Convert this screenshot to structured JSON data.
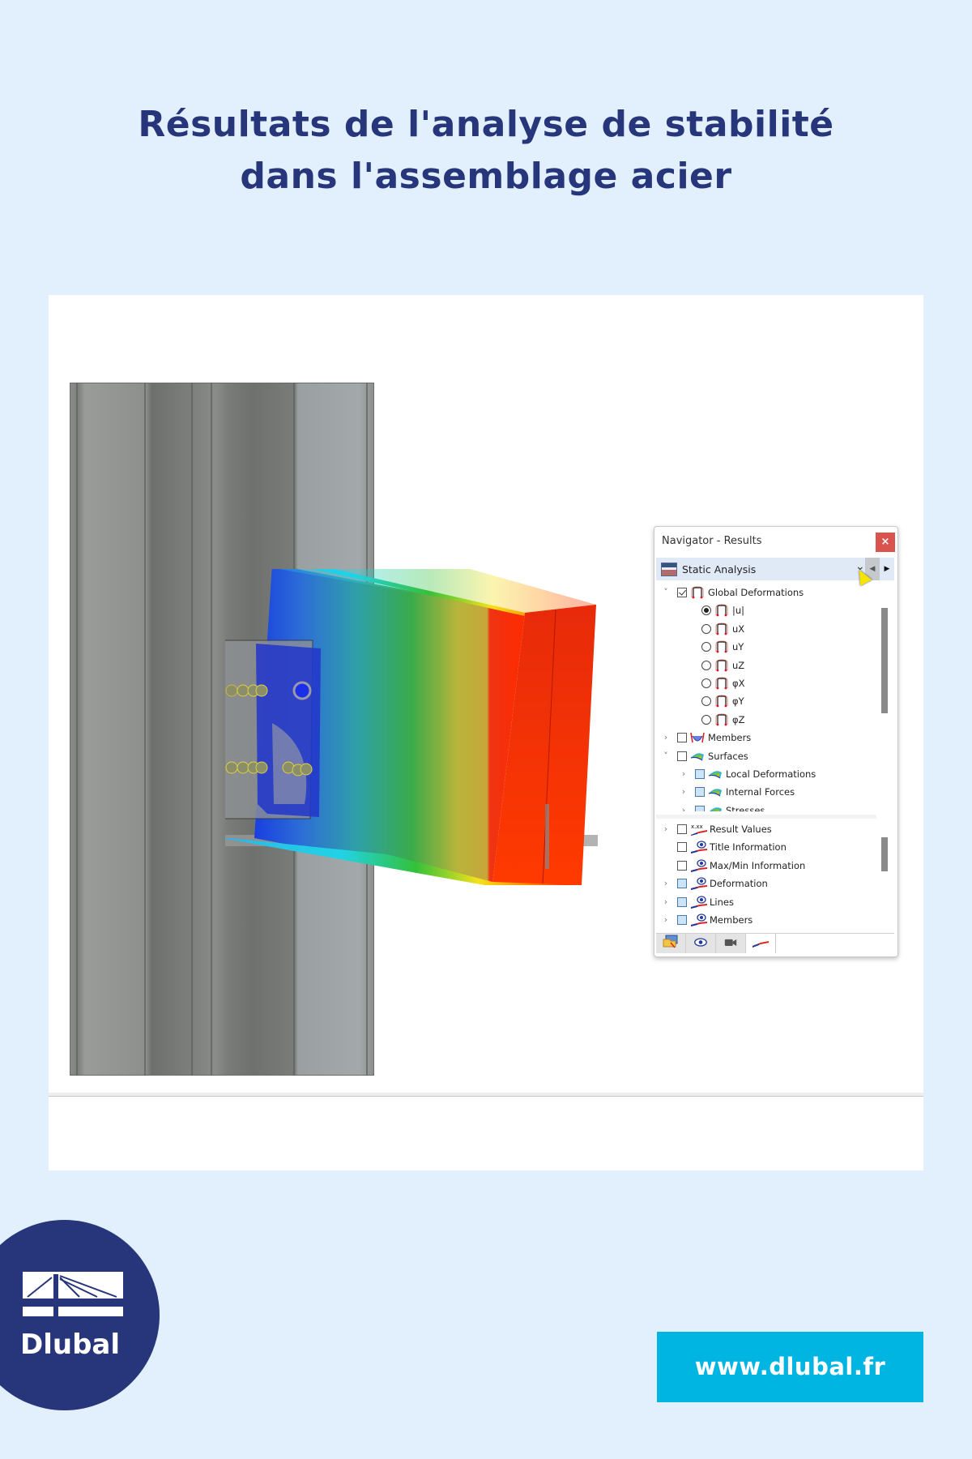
{
  "title": {
    "line1": "Résultats de l'analyse de stabilité",
    "line2": "dans l'assemblage acier"
  },
  "navigator": {
    "title": "Navigator - Results",
    "close_icon": "×",
    "combo": {
      "selected": "Static Analysis",
      "prev_icon": "◀",
      "next_icon": "▶",
      "chevron": "⌄"
    },
    "tree_top": [
      {
        "label": "Global Deformations",
        "level": 0,
        "expander": "˅",
        "control": "checkbox",
        "checked": true,
        "icon": "deformation-icon"
      },
      {
        "label": "|u|",
        "level": 1,
        "control": "radio",
        "selected": true,
        "icon": "deformation-icon"
      },
      {
        "label": "uX",
        "level": 1,
        "control": "radio",
        "selected": false,
        "icon": "deformation-icon"
      },
      {
        "label": "uY",
        "level": 1,
        "control": "radio",
        "selected": false,
        "icon": "deformation-icon"
      },
      {
        "label": "uZ",
        "level": 1,
        "control": "radio",
        "selected": false,
        "icon": "deformation-icon"
      },
      {
        "label": "φX",
        "level": 1,
        "control": "radio",
        "selected": false,
        "icon": "deformation-icon"
      },
      {
        "label": "φY",
        "level": 1,
        "control": "radio",
        "selected": false,
        "icon": "deformation-icon"
      },
      {
        "label": "φZ",
        "level": 1,
        "control": "radio",
        "selected": false,
        "icon": "deformation-icon"
      },
      {
        "label": "Members",
        "level": 0,
        "expander": "›",
        "control": "checkbox",
        "checked": false,
        "icon": "members-result-icon"
      },
      {
        "label": "Surfaces",
        "level": 0,
        "expander": "˅",
        "control": "checkbox",
        "checked": false,
        "icon": "surface-result-icon"
      },
      {
        "label": "Local Deformations",
        "level": 1,
        "expander": "›",
        "control": "checkbox-blue",
        "checked": false,
        "icon": "surface-result-icon"
      },
      {
        "label": "Internal Forces",
        "level": 1,
        "expander": "›",
        "control": "checkbox-blue",
        "checked": false,
        "icon": "surface-result-icon"
      },
      {
        "label": "Stresses",
        "level": 1,
        "expander": "›",
        "control": "checkbox-blue",
        "checked": false,
        "icon": "surface-result-icon"
      }
    ],
    "tree_bottom": [
      {
        "label": "Result Values",
        "expander": "›",
        "control": "checkbox",
        "icon": "result-values-icon",
        "icon_text": "x.xx"
      },
      {
        "label": "Title Information",
        "control": "checkbox",
        "icon": "display-eye-icon"
      },
      {
        "label": "Max/Min Information",
        "control": "checkbox",
        "icon": "display-eye-icon"
      },
      {
        "label": "Deformation",
        "expander": "›",
        "control": "checkbox-blue",
        "icon": "display-eye-icon"
      },
      {
        "label": "Lines",
        "expander": "›",
        "control": "checkbox-blue",
        "icon": "display-eye-icon"
      },
      {
        "label": "Members",
        "expander": "›",
        "control": "checkbox-blue",
        "icon": "display-eye-icon"
      }
    ],
    "tabs": [
      {
        "name": "data-tab",
        "icon": "data-navigator-icon",
        "active": false
      },
      {
        "name": "display-tab",
        "icon": "eye-icon",
        "active": false
      },
      {
        "name": "views-tab",
        "icon": "camera-icon",
        "active": false
      },
      {
        "name": "results-tab",
        "icon": "results-icon",
        "active": true
      }
    ]
  },
  "footer": {
    "logo_text": "Dlubal",
    "url": "www.dlubal.fr"
  },
  "colors": {
    "background": "#e2f0fd",
    "title": "#27357a",
    "logo_bg": "#27357a",
    "url_bg": "#00b5e2",
    "close_button": "#d9534f"
  }
}
